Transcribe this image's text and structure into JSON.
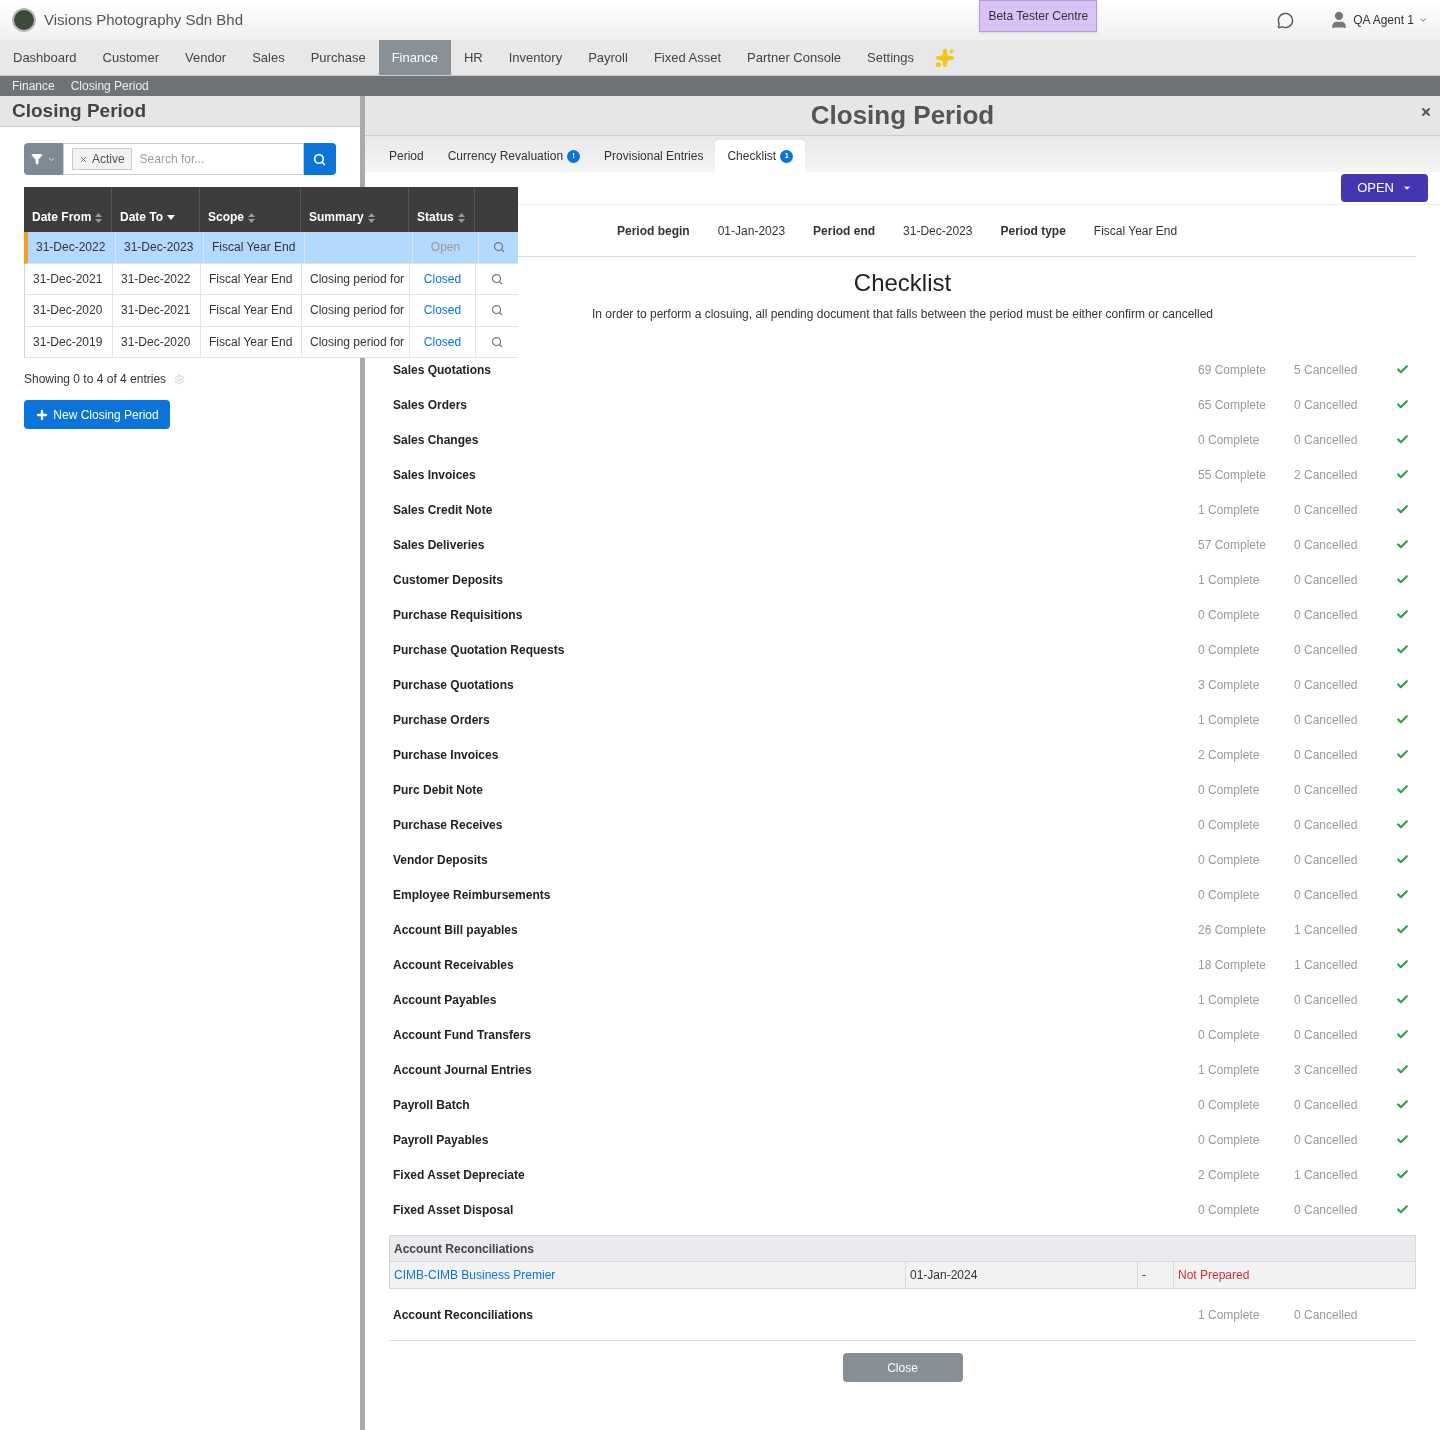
{
  "header": {
    "company": "Visions Photography Sdn Bhd",
    "beta_button": "Beta Tester Centre",
    "user": "QA Agent 1"
  },
  "nav": [
    {
      "label": "Dashboard",
      "selected": false
    },
    {
      "label": "Customer",
      "selected": false
    },
    {
      "label": "Vendor",
      "selected": false
    },
    {
      "label": "Sales",
      "selected": false
    },
    {
      "label": "Purchase",
      "selected": false
    },
    {
      "label": "Finance",
      "selected": true
    },
    {
      "label": "HR",
      "selected": false
    },
    {
      "label": "Inventory",
      "selected": false
    },
    {
      "label": "Payroll",
      "selected": false
    },
    {
      "label": "Fixed Asset",
      "selected": false
    },
    {
      "label": "Partner Console",
      "selected": false
    },
    {
      "label": "Settings",
      "selected": false
    }
  ],
  "breadcrumb": [
    "Finance",
    "Closing Period"
  ],
  "left": {
    "title": "Closing Period",
    "filter_chip": "Active",
    "search": {
      "placeholder": "Search for..."
    },
    "columns": [
      {
        "label": "Date From",
        "sorted_desc": false
      },
      {
        "label": "Date To",
        "sorted_desc": true
      },
      {
        "label": "Scope",
        "sorted_desc": false
      },
      {
        "label": "Summary",
        "sorted_desc": false
      },
      {
        "label": "Status",
        "sorted_desc": false
      }
    ],
    "rows": [
      {
        "from": "31-Dec-2022",
        "to": "31-Dec-2023",
        "scope": "Fiscal Year End",
        "summary": "",
        "status": "Open",
        "selected": true
      },
      {
        "from": "31-Dec-2021",
        "to": "31-Dec-2022",
        "scope": "Fiscal Year End",
        "summary": "Closing period for",
        "status": "Closed",
        "selected": false
      },
      {
        "from": "31-Dec-2020",
        "to": "31-Dec-2021",
        "scope": "Fiscal Year End",
        "summary": "Closing period for",
        "status": "Closed",
        "selected": false
      },
      {
        "from": "31-Dec-2019",
        "to": "31-Dec-2020",
        "scope": "Fiscal Year End",
        "summary": "Closing period for",
        "status": "Closed",
        "selected": false
      }
    ],
    "info": "Showing 0 to 4 of 4 entries",
    "new_button": "New Closing Period"
  },
  "modal": {
    "title": "Closing Period",
    "tabs": [
      {
        "label": "Period",
        "selected": false
      },
      {
        "label": "Currency Revaluation",
        "badge": "!",
        "selected": false
      },
      {
        "label": "Provisional Entries",
        "selected": false
      },
      {
        "label": "Checklist",
        "badge": "1",
        "selected": true
      }
    ],
    "status_button": "OPEN",
    "period": [
      {
        "label": "Period begin",
        "value": "01-Jan-2023"
      },
      {
        "label": "Period end",
        "value": "31-Dec-2023"
      },
      {
        "label": "Period type",
        "value": "Fiscal Year End"
      }
    ],
    "heading": "Checklist",
    "description": "In order to perform a closuing, all pending document that falls between the period must be either confirm or cancelled",
    "items": [
      {
        "kind": "row",
        "name": "Sales Quotations",
        "complete": "69 Complete",
        "cancelled": "5 Cancelled",
        "ok": true
      },
      {
        "kind": "row",
        "name": "Sales Orders",
        "complete": "65 Complete",
        "cancelled": "0 Cancelled",
        "ok": true
      },
      {
        "kind": "row",
        "name": "Sales Changes",
        "complete": "0 Complete",
        "cancelled": "0 Cancelled",
        "ok": true
      },
      {
        "kind": "row",
        "name": "Sales Invoices",
        "complete": "55 Complete",
        "cancelled": "2 Cancelled",
        "ok": true
      },
      {
        "kind": "row",
        "name": "Sales Credit Note",
        "complete": "1 Complete",
        "cancelled": "0 Cancelled",
        "ok": true
      },
      {
        "kind": "row",
        "name": "Sales Deliveries",
        "complete": "57 Complete",
        "cancelled": "0 Cancelled",
        "ok": true
      },
      {
        "kind": "row",
        "name": "Customer Deposits",
        "complete": "1 Complete",
        "cancelled": "0 Cancelled",
        "ok": true
      },
      {
        "kind": "row",
        "name": "Purchase Requisitions",
        "complete": "0 Complete",
        "cancelled": "0 Cancelled",
        "ok": true
      },
      {
        "kind": "row",
        "name": "Purchase Quotation Requests",
        "complete": "0 Complete",
        "cancelled": "0 Cancelled",
        "ok": true
      },
      {
        "kind": "row",
        "name": "Purchase Quotations",
        "complete": "3 Complete",
        "cancelled": "0 Cancelled",
        "ok": true
      },
      {
        "kind": "row",
        "name": "Purchase Orders",
        "complete": "1 Complete",
        "cancelled": "0 Cancelled",
        "ok": true
      },
      {
        "kind": "row",
        "name": "Purchase Invoices",
        "complete": "2 Complete",
        "cancelled": "0 Cancelled",
        "ok": true
      },
      {
        "kind": "row",
        "name": "Purc Debit Note",
        "complete": "0 Complete",
        "cancelled": "0 Cancelled",
        "ok": true
      },
      {
        "kind": "row",
        "name": "Purchase Receives",
        "complete": "0 Complete",
        "cancelled": "0 Cancelled",
        "ok": true
      },
      {
        "kind": "row",
        "name": "Vendor Deposits",
        "complete": "0 Complete",
        "cancelled": "0 Cancelled",
        "ok": true
      },
      {
        "kind": "row",
        "name": "Employee Reimbursements",
        "complete": "0 Complete",
        "cancelled": "0 Cancelled",
        "ok": true
      },
      {
        "kind": "row",
        "name": "Account Bill payables",
        "complete": "26 Complete",
        "cancelled": "1 Cancelled",
        "ok": true
      },
      {
        "kind": "row",
        "name": "Account Receivables",
        "complete": "18 Complete",
        "cancelled": "1 Cancelled",
        "ok": true
      },
      {
        "kind": "row",
        "name": "Account Payables",
        "complete": "1 Complete",
        "cancelled": "0 Cancelled",
        "ok": true
      },
      {
        "kind": "row",
        "name": "Account Fund Transfers",
        "complete": "0 Complete",
        "cancelled": "0 Cancelled",
        "ok": true
      },
      {
        "kind": "row",
        "name": "Account Journal Entries",
        "complete": "1 Complete",
        "cancelled": "3 Cancelled",
        "ok": true
      },
      {
        "kind": "row",
        "name": "Payroll Batch",
        "complete": "0 Complete",
        "cancelled": "0 Cancelled",
        "ok": true
      },
      {
        "kind": "row",
        "name": "Payroll Payables",
        "complete": "0 Complete",
        "cancelled": "0 Cancelled",
        "ok": true
      },
      {
        "kind": "row",
        "name": "Fixed Asset Depreciate",
        "complete": "2 Complete",
        "cancelled": "1 Cancelled",
        "ok": true
      },
      {
        "kind": "row",
        "name": "Fixed Asset Disposal",
        "complete": "0 Complete",
        "cancelled": "0 Cancelled",
        "ok": true
      },
      {
        "kind": "table",
        "title": "Account Reconciliations",
        "rows": [
          {
            "account": "CIMB-CIMB Business Premier",
            "date": "01-Jan-2024",
            "column_3": "-",
            "status": "Not Prepared"
          }
        ]
      },
      {
        "kind": "row",
        "name": "Account Reconciliations",
        "complete": "1 Complete",
        "cancelled": "0 Cancelled",
        "ok": false
      }
    ],
    "close_button": "Close"
  }
}
